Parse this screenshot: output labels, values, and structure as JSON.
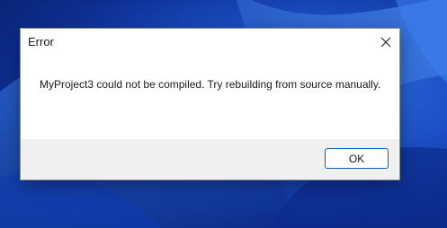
{
  "dialog": {
    "title": "Error",
    "message": "MyProject3 could not be compiled. Try rebuilding from source manually.",
    "ok_label": "OK",
    "close_icon": "close-icon"
  },
  "colors": {
    "accent": "#0067c0",
    "footer_bg": "#f0f0f0",
    "desktop_blue": "#1c4fc4"
  }
}
